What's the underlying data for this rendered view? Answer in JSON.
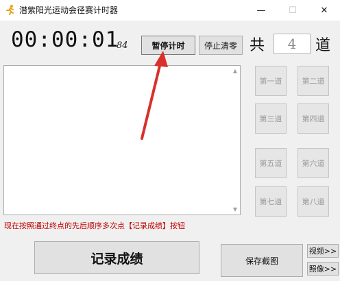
{
  "window": {
    "title": "潜紫阳光运动会径赛计时器",
    "minimize": "—",
    "maximize": "☐",
    "close": "✕"
  },
  "timer": {
    "display": "00:00:01",
    "milliseconds": "84"
  },
  "controls": {
    "pause_label": "暂停计时",
    "stop_clear_label": "停止清零",
    "total_prefix": "共",
    "lane_count": "4",
    "total_suffix": "道"
  },
  "lanes": [
    "第一道",
    "第二道",
    "第三道",
    "第四道",
    "第五道",
    "第六道",
    "第七道",
    "第八道"
  ],
  "hint": "现在按照通过终点的先后顺序多次点【记录成绩】按钮",
  "actions": {
    "record_label": "记录成绩",
    "save_screenshot_label": "保存截图",
    "video_label": "视频>>",
    "photo_label": "照像>>"
  },
  "colors": {
    "hint_text": "#c00000",
    "annotation_arrow": "#d9302a"
  },
  "icons": {
    "app": "runner-icon",
    "scroll_up": "scroll-up-icon",
    "scroll_down": "scroll-down-icon"
  }
}
